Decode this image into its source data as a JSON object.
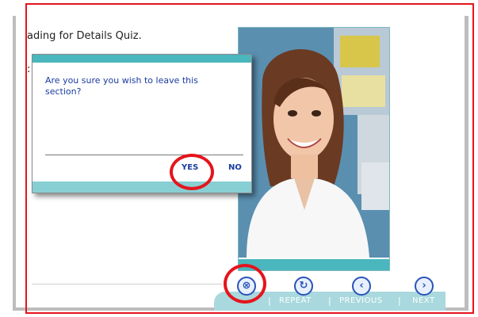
{
  "page": {
    "title": "ading for Details Quiz.",
    "hint_char": ":"
  },
  "dialog": {
    "message": "Are you sure you wish to leave this section?",
    "yes_label": "YES",
    "no_label": "NO"
  },
  "nav": {
    "items": [
      {
        "label": "",
        "icon": "close-icon",
        "glyph": "⊗"
      },
      {
        "label": "REPEAT",
        "icon": "repeat-icon",
        "glyph": "↻"
      },
      {
        "label": "PREVIOUS",
        "icon": "previous-icon",
        "glyph": "‹"
      },
      {
        "label": "NEXT",
        "icon": "next-icon",
        "glyph": "›"
      }
    ],
    "separator": "|"
  },
  "colors": {
    "accent_teal": "#4ab6bd",
    "nav_bar": "#a9d9de",
    "link_blue": "#1a3c9e",
    "annotation_red": "#e4151d"
  }
}
